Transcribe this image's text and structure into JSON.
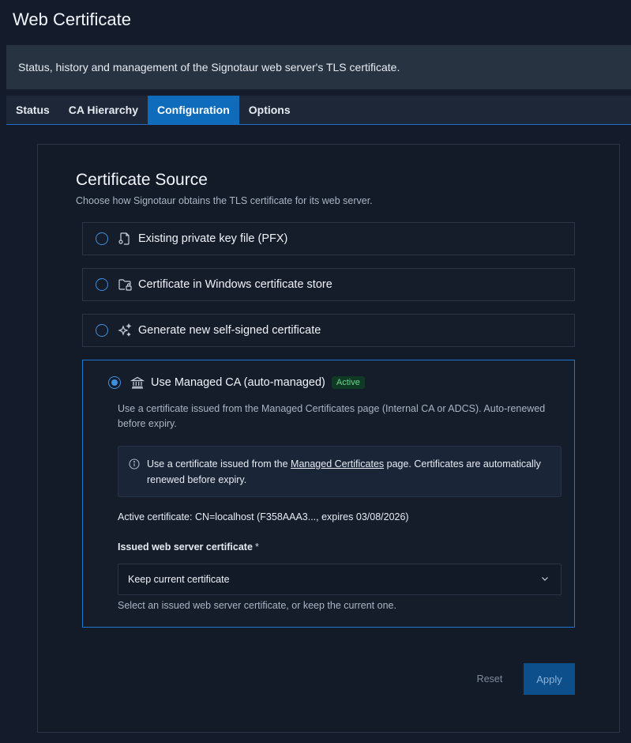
{
  "page": {
    "title": "Web Certificate",
    "description": "Status, history and management of the Signotaur web server's TLS certificate."
  },
  "tabs": [
    {
      "label": "Status"
    },
    {
      "label": "CA Hierarchy"
    },
    {
      "label": "Configuration",
      "active": true
    },
    {
      "label": "Options"
    }
  ],
  "certificate_source": {
    "title": "Certificate Source",
    "subtitle": "Choose how Signotaur obtains the TLS certificate for its web server.",
    "options": [
      {
        "label": "Existing private key file (PFX)",
        "icon": "file-key-icon"
      },
      {
        "label": "Certificate in Windows certificate store",
        "icon": "folder-lock-icon"
      },
      {
        "label": "Generate new self-signed certificate",
        "icon": "sparkle-icon"
      },
      {
        "label": "Use Managed CA (auto-managed)",
        "icon": "bank-icon",
        "selected": true
      }
    ],
    "managed": {
      "badge": "Active",
      "description": "Use a certificate issued from the Managed Certificates page (Internal CA or ADCS). Auto-renewed before expiry.",
      "info_prefix": "Use a certificate issued from the ",
      "info_link": "Managed Certificates",
      "info_suffix": " page. Certificates are automatically renewed before expiry.",
      "active_cert": "Active certificate: CN=localhost (F358AAA3..., expires 03/08/2026)",
      "field_label": "Issued web server certificate",
      "required_mark": "*",
      "select_value": "Keep current certificate",
      "hint": "Select an issued web server certificate, or keep the current one."
    }
  },
  "actions": {
    "reset_label": "Reset",
    "apply_label": "Apply"
  },
  "colors": {
    "accent": "#0f6cbd",
    "badge_bg": "#0f3a24",
    "badge_text": "#6fd38d"
  }
}
